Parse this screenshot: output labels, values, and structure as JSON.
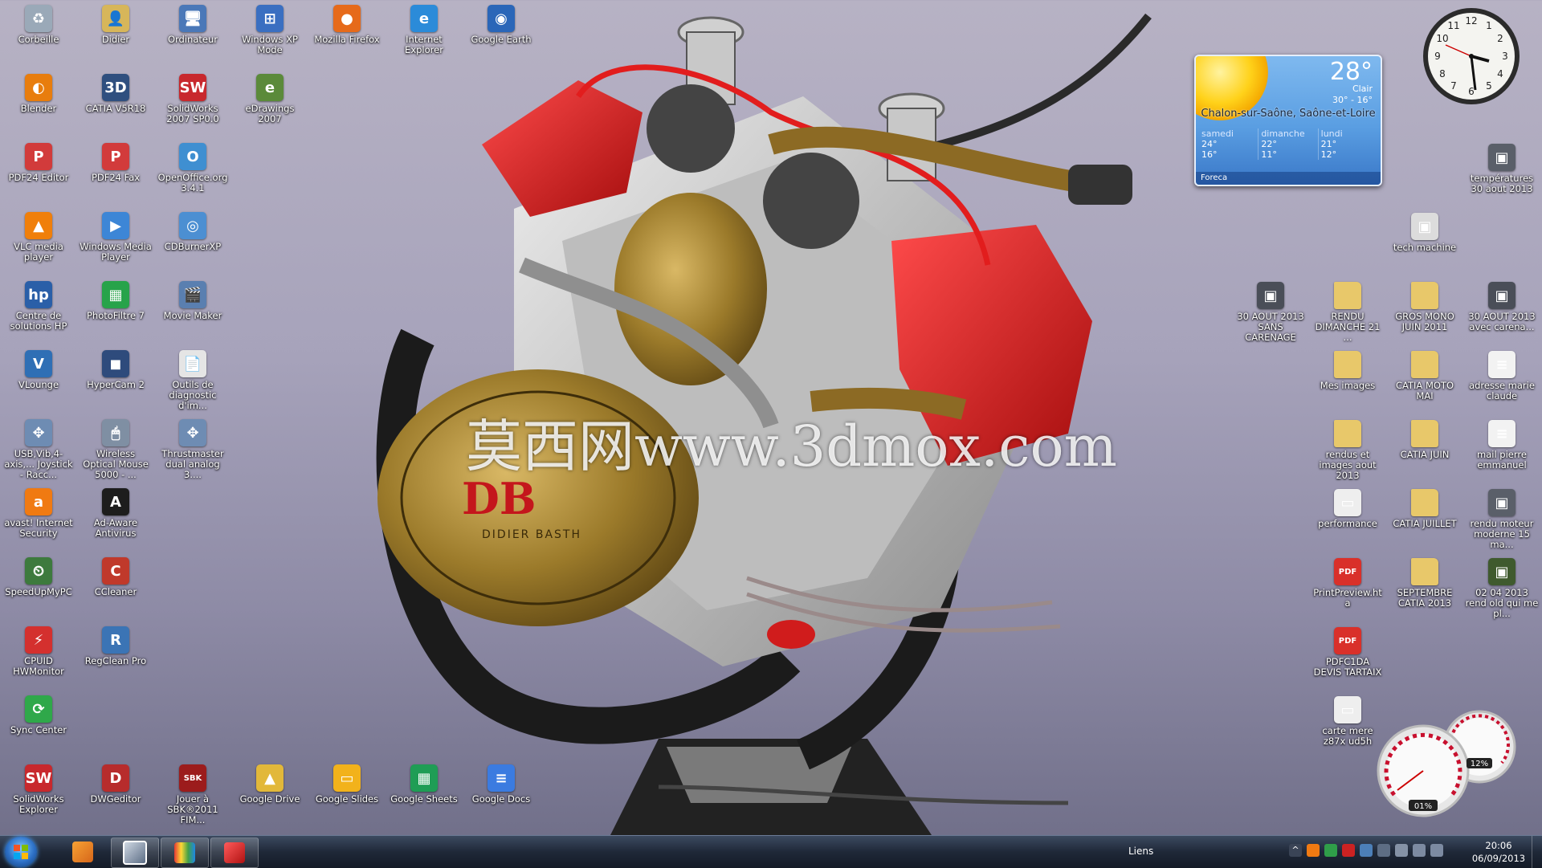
{
  "desktop": {
    "left_icons": [
      {
        "label": "Corbeille",
        "icon": "recycle-bin-icon",
        "color": "#9aa9b8",
        "glyph": "♻"
      },
      {
        "label": "Didier",
        "icon": "user-folder-icon",
        "color": "#d7b65a",
        "glyph": "👤"
      },
      {
        "label": "Ordinateur",
        "icon": "computer-icon",
        "color": "#4a78b8",
        "glyph": "🖥"
      },
      {
        "label": "Windows XP Mode",
        "icon": "windows-xp-mode-icon",
        "color": "#3a6fc1",
        "glyph": "⊞"
      },
      {
        "label": "Mozilla Firefox",
        "icon": "firefox-icon",
        "color": "#e66a1a",
        "glyph": "●"
      },
      {
        "label": "Internet Explorer",
        "icon": "internet-explorer-icon",
        "color": "#2b8bd9",
        "glyph": "e"
      },
      {
        "label": "Google Earth",
        "icon": "google-earth-icon",
        "color": "#2a66b8",
        "glyph": "◉"
      },
      {
        "label": "Blender",
        "icon": "blender-icon",
        "color": "#e87d0d",
        "glyph": "◐"
      },
      {
        "label": "CATIA V5R18",
        "icon": "catia-icon",
        "color": "#2f4f7f",
        "glyph": "3D"
      },
      {
        "label": "SolidWorks 2007 SP0.0",
        "icon": "solidworks-icon",
        "color": "#c8282d",
        "glyph": "SW"
      },
      {
        "label": "eDrawings 2007",
        "icon": "edrawings-icon",
        "color": "#5b8a3a",
        "glyph": "e"
      },
      {
        "label": "PDF24 Editor",
        "icon": "pdf24-editor-icon",
        "color": "#d23b3b",
        "glyph": "P"
      },
      {
        "label": "PDF24 Fax",
        "icon": "pdf24-fax-icon",
        "color": "#d23b3b",
        "glyph": "P"
      },
      {
        "label": "OpenOffice.org 3.4.1",
        "icon": "openoffice-icon",
        "color": "#3f8fd1",
        "glyph": "O"
      },
      {
        "label": "VLC media player",
        "icon": "vlc-icon",
        "color": "#f07f0a",
        "glyph": "▲"
      },
      {
        "label": "Windows Media Player",
        "icon": "media-player-icon",
        "color": "#3d86d6",
        "glyph": "▶"
      },
      {
        "label": "CDBurnerXP",
        "icon": "cdburner-icon",
        "color": "#4c8fd2",
        "glyph": "◎"
      },
      {
        "label": "Centre de solutions HP",
        "icon": "hp-solution-center-icon",
        "color": "#2a5fa8",
        "glyph": "hp"
      },
      {
        "label": "PhotoFiltre 7",
        "icon": "photofiltre-icon",
        "color": "#27a34a",
        "glyph": "▦"
      },
      {
        "label": "Movie Maker",
        "icon": "movie-maker-icon",
        "color": "#5a7fb0",
        "glyph": "🎬"
      },
      {
        "label": "VLounge",
        "icon": "vlounge-icon",
        "color": "#2f6fb5",
        "glyph": "V"
      },
      {
        "label": "HyperCam 2",
        "icon": "hypercam-icon",
        "color": "#2e4b7c",
        "glyph": "◼"
      },
      {
        "label": "Outils de diagnostic d'im...",
        "icon": "diagnostic-icon",
        "color": "#e5e5e5",
        "glyph": "📄"
      },
      {
        "label": "USB,Vib,4-axis,... Joystick - Racc...",
        "icon": "joystick-icon",
        "color": "#6e8cb3",
        "glyph": "✥"
      },
      {
        "label": "Wireless Optical Mouse 5000 - ...",
        "icon": "mouse-icon",
        "color": "#7f8fa3",
        "glyph": "🖱"
      },
      {
        "label": "Thrustmaster dual analog 3....",
        "icon": "gamepad-icon",
        "color": "#6e8cb3",
        "glyph": "✥"
      },
      {
        "label": "avast! Internet Security",
        "icon": "avast-icon",
        "color": "#f07a12",
        "glyph": "a"
      },
      {
        "label": "Ad-Aware Antivirus",
        "icon": "adaware-icon",
        "color": "#1d1d1d",
        "glyph": "A"
      },
      {
        "label": "SpeedUpMyPC",
        "icon": "speedupmypc-icon",
        "color": "#3d7a3d",
        "glyph": "⏲"
      },
      {
        "label": "CCleaner",
        "icon": "ccleaner-icon",
        "color": "#c0392b",
        "glyph": "C"
      },
      {
        "label": "CPUID HWMonitor",
        "icon": "hwmonitor-icon",
        "color": "#d4302e",
        "glyph": "⚡"
      },
      {
        "label": "RegClean Pro",
        "icon": "regclean-icon",
        "color": "#3b74b5",
        "glyph": "R"
      },
      {
        "label": "Sync Center",
        "icon": "sync-center-icon",
        "color": "#2fa84a",
        "glyph": "⟳"
      },
      {
        "label": "SolidWorks Explorer",
        "icon": "solidworks-explorer-icon",
        "color": "#c8282d",
        "glyph": "SW"
      },
      {
        "label": "DWGeditor",
        "icon": "dwgeditor-icon",
        "color": "#b72c2c",
        "glyph": "D"
      },
      {
        "label": "Jouer à SBK®2011 FIM...",
        "icon": "sbk-game-icon",
        "color": "#9c1c1c",
        "glyph": "SBK"
      },
      {
        "label": "Google Drive",
        "icon": "google-drive-icon",
        "color": "#e2b83a",
        "glyph": "▲"
      },
      {
        "label": "Google Slides",
        "icon": "google-slides-icon",
        "color": "#f2b21b",
        "glyph": "▭"
      },
      {
        "label": "Google Sheets",
        "icon": "google-sheets-icon",
        "color": "#1f9d55",
        "glyph": "▦"
      },
      {
        "label": "Google Docs",
        "icon": "google-docs-icon",
        "color": "#3b7be0",
        "glyph": "≡"
      }
    ],
    "right_icons": [
      {
        "label": "températures 30 aout 2013",
        "icon": "image-file-icon",
        "color": "#5a5f69",
        "glyph": "▣"
      },
      {
        "label": "tech machine",
        "icon": "image-file-icon",
        "color": "#dcdcdc",
        "glyph": "▣"
      },
      {
        "label": "30 AOUT 2013 SANS CARENAGE",
        "icon": "image-file-icon",
        "color": "#4a4e58",
        "glyph": "▣"
      },
      {
        "label": "RENDU DIMANCHE 21 ...",
        "icon": "folder-icon",
        "color": "#e8c86a",
        "glyph": ""
      },
      {
        "label": "GROS MONO JUIN 2011",
        "icon": "folder-icon",
        "color": "#e8c86a",
        "glyph": ""
      },
      {
        "label": "30 AOUT 2013 avec carena...",
        "icon": "image-file-icon",
        "color": "#4a4e58",
        "glyph": "▣"
      },
      {
        "label": "Mes images",
        "icon": "folder-icon",
        "color": "#e8c86a",
        "glyph": ""
      },
      {
        "label": "CATIA MOTO MAI",
        "icon": "folder-icon",
        "color": "#e8c86a",
        "glyph": ""
      },
      {
        "label": "adresse marie claude",
        "icon": "text-file-icon",
        "color": "#f2f2f2",
        "glyph": "≡"
      },
      {
        "label": "rendus et images aout 2013",
        "icon": "folder-icon",
        "color": "#e8c86a",
        "glyph": ""
      },
      {
        "label": "CATIA JUIN",
        "icon": "folder-icon",
        "color": "#e8c86a",
        "glyph": ""
      },
      {
        "label": "mail pierre emmanuel",
        "icon": "text-file-icon",
        "color": "#f2f2f2",
        "glyph": "≡"
      },
      {
        "label": "performance",
        "icon": "performance-file-icon",
        "color": "#eeeeee",
        "glyph": "▭"
      },
      {
        "label": "CATIA JUILLET",
        "icon": "folder-icon",
        "color": "#e8c86a",
        "glyph": ""
      },
      {
        "label": "rendu moteur moderne 15 ma...",
        "icon": "image-file-icon",
        "color": "#5a5f69",
        "glyph": "▣"
      },
      {
        "label": "PrintPreview.hta",
        "icon": "pdf-file-icon",
        "color": "#d9302a",
        "glyph": "PDF"
      },
      {
        "label": "SEPTEMBRE CATIA 2013",
        "icon": "folder-icon",
        "color": "#e8c86a",
        "glyph": ""
      },
      {
        "label": "02 04 2013 rend old qui me pl...",
        "icon": "image-file-icon",
        "color": "#3f5a2e",
        "glyph": "▣"
      },
      {
        "label": "PDFC1DA DEVIS TARTAIX",
        "icon": "pdf-file-icon",
        "color": "#d9302a",
        "glyph": "PDF"
      },
      {
        "label": "carte mere z87x ud5h",
        "icon": "image-file-icon",
        "color": "#eeeeee",
        "glyph": "▭"
      }
    ]
  },
  "watermark": "莫西网www.3dmox.com",
  "emblem": {
    "monogram": "DB",
    "text": "DIDIER BASTH"
  },
  "weather": {
    "temp": "28°",
    "condition": "Clair",
    "range": "30° - 16°",
    "city": "Chalon-sur-Saône, Saône-et-Loire",
    "forecast": [
      {
        "day": "samedi",
        "high": "24°",
        "low": "16°"
      },
      {
        "day": "dimanche",
        "high": "22°",
        "low": "11°"
      },
      {
        "day": "lundi",
        "high": "21°",
        "low": "12°"
      }
    ],
    "provider": "Foreca"
  },
  "meters": {
    "cpu": "01%",
    "memory": "12%"
  },
  "taskbar": {
    "links_label": "Liens",
    "time": "20:06",
    "date": "06/09/2013"
  }
}
